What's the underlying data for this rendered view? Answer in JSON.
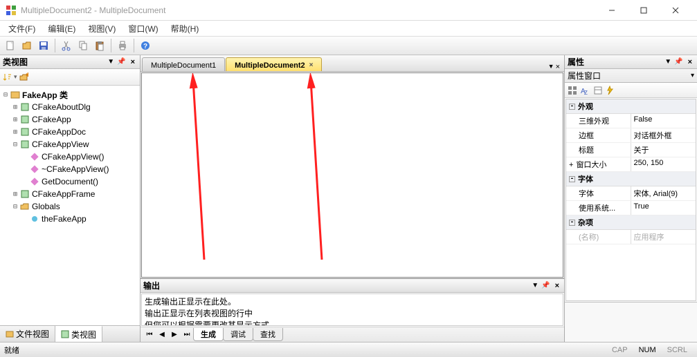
{
  "window": {
    "title": "MultipleDocument2 - MultipleDocument"
  },
  "menu": {
    "file": "文件(F)",
    "edit": "编辑(E)",
    "view": "视图(V)",
    "window": "窗口(W)",
    "help": "帮助(H)"
  },
  "class_view": {
    "title": "类视图",
    "tree": {
      "root": "FakeApp 类",
      "n1": "CFakeAboutDlg",
      "n2": "CFakeApp",
      "n3": "CFakeAppDoc",
      "n4": "CFakeAppView",
      "n4a": "CFakeAppView()",
      "n4b": "~CFakeAppView()",
      "n4c": "GetDocument()",
      "n5": "CFakeAppFrame",
      "n6": "Globals",
      "n6a": "theFakeApp"
    },
    "tab_file": "文件视图",
    "tab_class": "类视图"
  },
  "docs": {
    "tab1": "MultipleDocument1",
    "tab2": "MultipleDocument2"
  },
  "output": {
    "title": "输出",
    "line1": "生成输出正显示在此处。",
    "line2": "输出正显示在列表视图的行中",
    "line3": "但您可以根据需要更改其显示方式...",
    "tab_build": "生成",
    "tab_debug": "调试",
    "tab_find": "查找"
  },
  "props": {
    "panel_title": "属性",
    "window_title": "属性窗口",
    "cat_appearance": "外观",
    "r1n": "三维外观",
    "r1v": "False",
    "r2n": "边框",
    "r2v": "对话框外框",
    "r3n": "标题",
    "r3v": "关于",
    "r4n": "窗口大小",
    "r4v": "250, 150",
    "cat_font": "字体",
    "r5n": "字体",
    "r5v": "宋体, Arial(9)",
    "r6n": "使用系统...",
    "r6v": "True",
    "cat_misc": "杂项",
    "r7n": "(名称)",
    "r7v": "应用程序"
  },
  "status": {
    "ready": "就绪",
    "cap": "CAP",
    "num": "NUM",
    "scrl": "SCRL"
  }
}
